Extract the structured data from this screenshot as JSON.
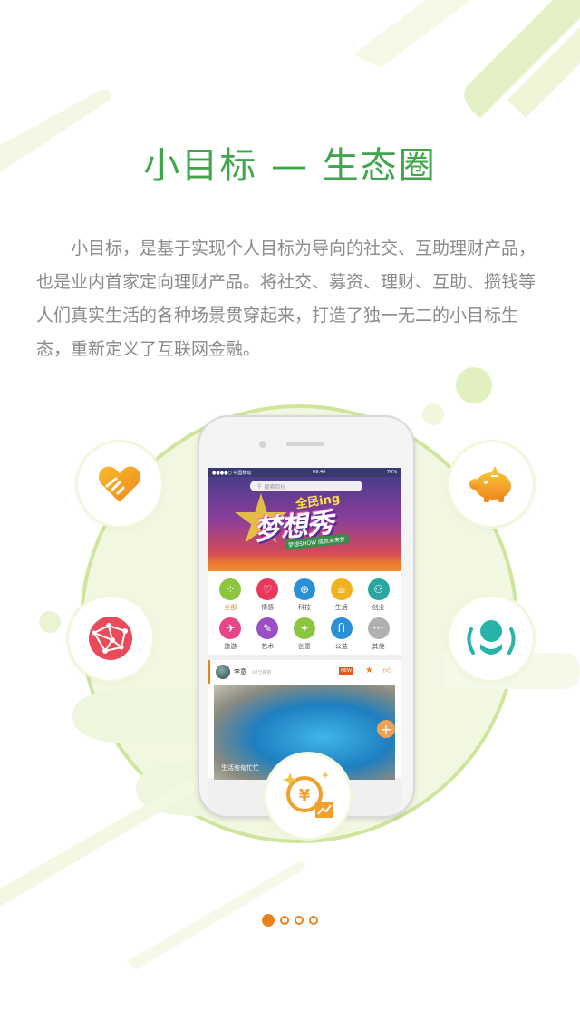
{
  "page": {
    "title": "小目标 — 生态圈",
    "description": "小目标，是基于实现个人目标为导向的社交、互助理财产品，也是业内首家定向理财产品。将社交、募资、理财、互助、攒钱等人们真实生活的各种场景贯穿起来，打造了独一无二的小目标生态，重新定义了互联网金融。",
    "title_color": "#3fa64a",
    "accent_color": "#e9821e"
  },
  "phone": {
    "status": {
      "carrier": "●●●●○ 中国移动",
      "time": "09:40",
      "battery": "70%"
    },
    "search": {
      "placeholder": "搜索目标",
      "icon": "search-icon"
    },
    "banner": {
      "top_text": "全民ing",
      "main_text": "梦想秀",
      "sub_text": "梦想SHOW 成就未来梦"
    },
    "categories": [
      {
        "label": "全部",
        "icon": "grid-icon",
        "glyph": "⁘",
        "color": "#8cc63f",
        "active": true
      },
      {
        "label": "情感",
        "icon": "heart-icon",
        "glyph": "♡",
        "color": "#e9385a",
        "active": false
      },
      {
        "label": "科技",
        "icon": "globe-icon",
        "glyph": "⊕",
        "color": "#2a8fd6",
        "active": false
      },
      {
        "label": "生活",
        "icon": "cup-icon",
        "glyph": "☕",
        "color": "#f0b21e",
        "active": false
      },
      {
        "label": "创业",
        "icon": "person-icon",
        "glyph": "⚇",
        "color": "#27a7a0",
        "active": false
      },
      {
        "label": "旅游",
        "icon": "plane-icon",
        "glyph": "✈",
        "color": "#e8458a",
        "active": false
      },
      {
        "label": "艺术",
        "icon": "art-icon",
        "glyph": "✎",
        "color": "#9a4fc4",
        "active": false
      },
      {
        "label": "创意",
        "icon": "bulb-icon",
        "glyph": "✦",
        "color": "#8cc63f",
        "active": false
      },
      {
        "label": "公益",
        "icon": "ribbon-icon",
        "glyph": "Ⴖ",
        "color": "#2a8fd6",
        "active": false
      },
      {
        "label": "其他",
        "icon": "more-icon",
        "glyph": "•••",
        "color": "#b0b0b0",
        "active": false
      }
    ],
    "post": {
      "user": "李意",
      "time": "10分钟前",
      "new_tag": "NEW",
      "fav_icon": "star-icon",
      "like_icon": "thumb-up-icon",
      "caption": "生活匆匆忙忙",
      "add_icon": "plus-icon"
    }
  },
  "floating_icons": {
    "top_left": "handshake-heart-icon",
    "mid_left": "network-globe-icon",
    "top_right": "piggy-bank-icon",
    "mid_right": "mutual-aid-icon",
    "bottom_center": "coin-growth-icon"
  },
  "pagination": {
    "total": 4,
    "current": 1
  }
}
